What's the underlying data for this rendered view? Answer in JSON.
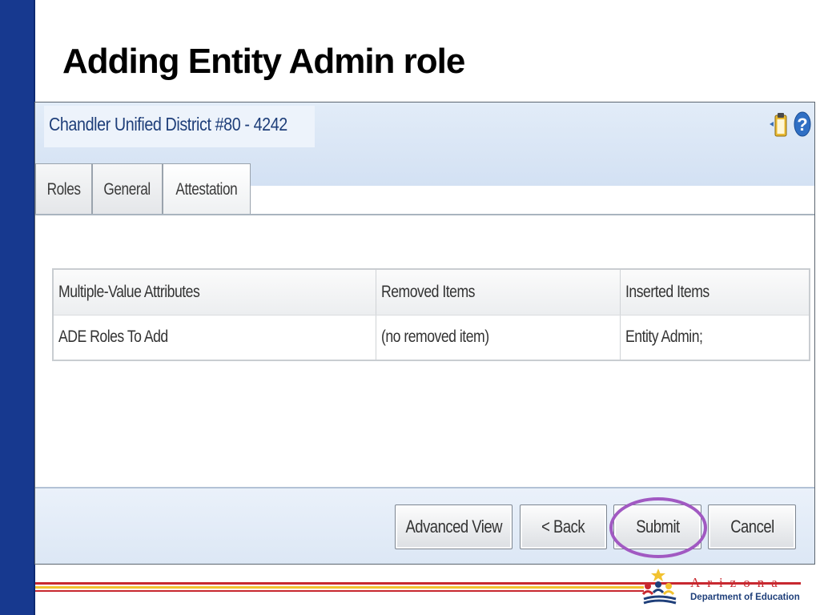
{
  "slide": {
    "title": "Adding Entity Admin role"
  },
  "app": {
    "org_name": "Chandler Unified District #80 - 4242",
    "icons": [
      "clipboard-icon",
      "help-icon"
    ],
    "tabs": [
      {
        "label": "Roles"
      },
      {
        "label": "General"
      },
      {
        "label": "Attestation",
        "active": true
      }
    ],
    "table": {
      "headers": [
        "Multiple-Value Attributes",
        "Removed Items",
        "Inserted Items"
      ],
      "rows": [
        [
          "ADE Roles To Add",
          "(no removed item)",
          "Entity Admin;"
        ]
      ]
    },
    "buttons": {
      "advanced_view": "Advanced View",
      "back": "< Back",
      "submit": "Submit",
      "cancel": "Cancel"
    }
  },
  "logo": {
    "word": "Arizona",
    "sub": "Department of Education"
  },
  "colors": {
    "sidebar": "#17398f",
    "highlight_circle": "#a159c2",
    "stripe_red": "#c8282f",
    "stripe_yellow": "#f2c230"
  }
}
